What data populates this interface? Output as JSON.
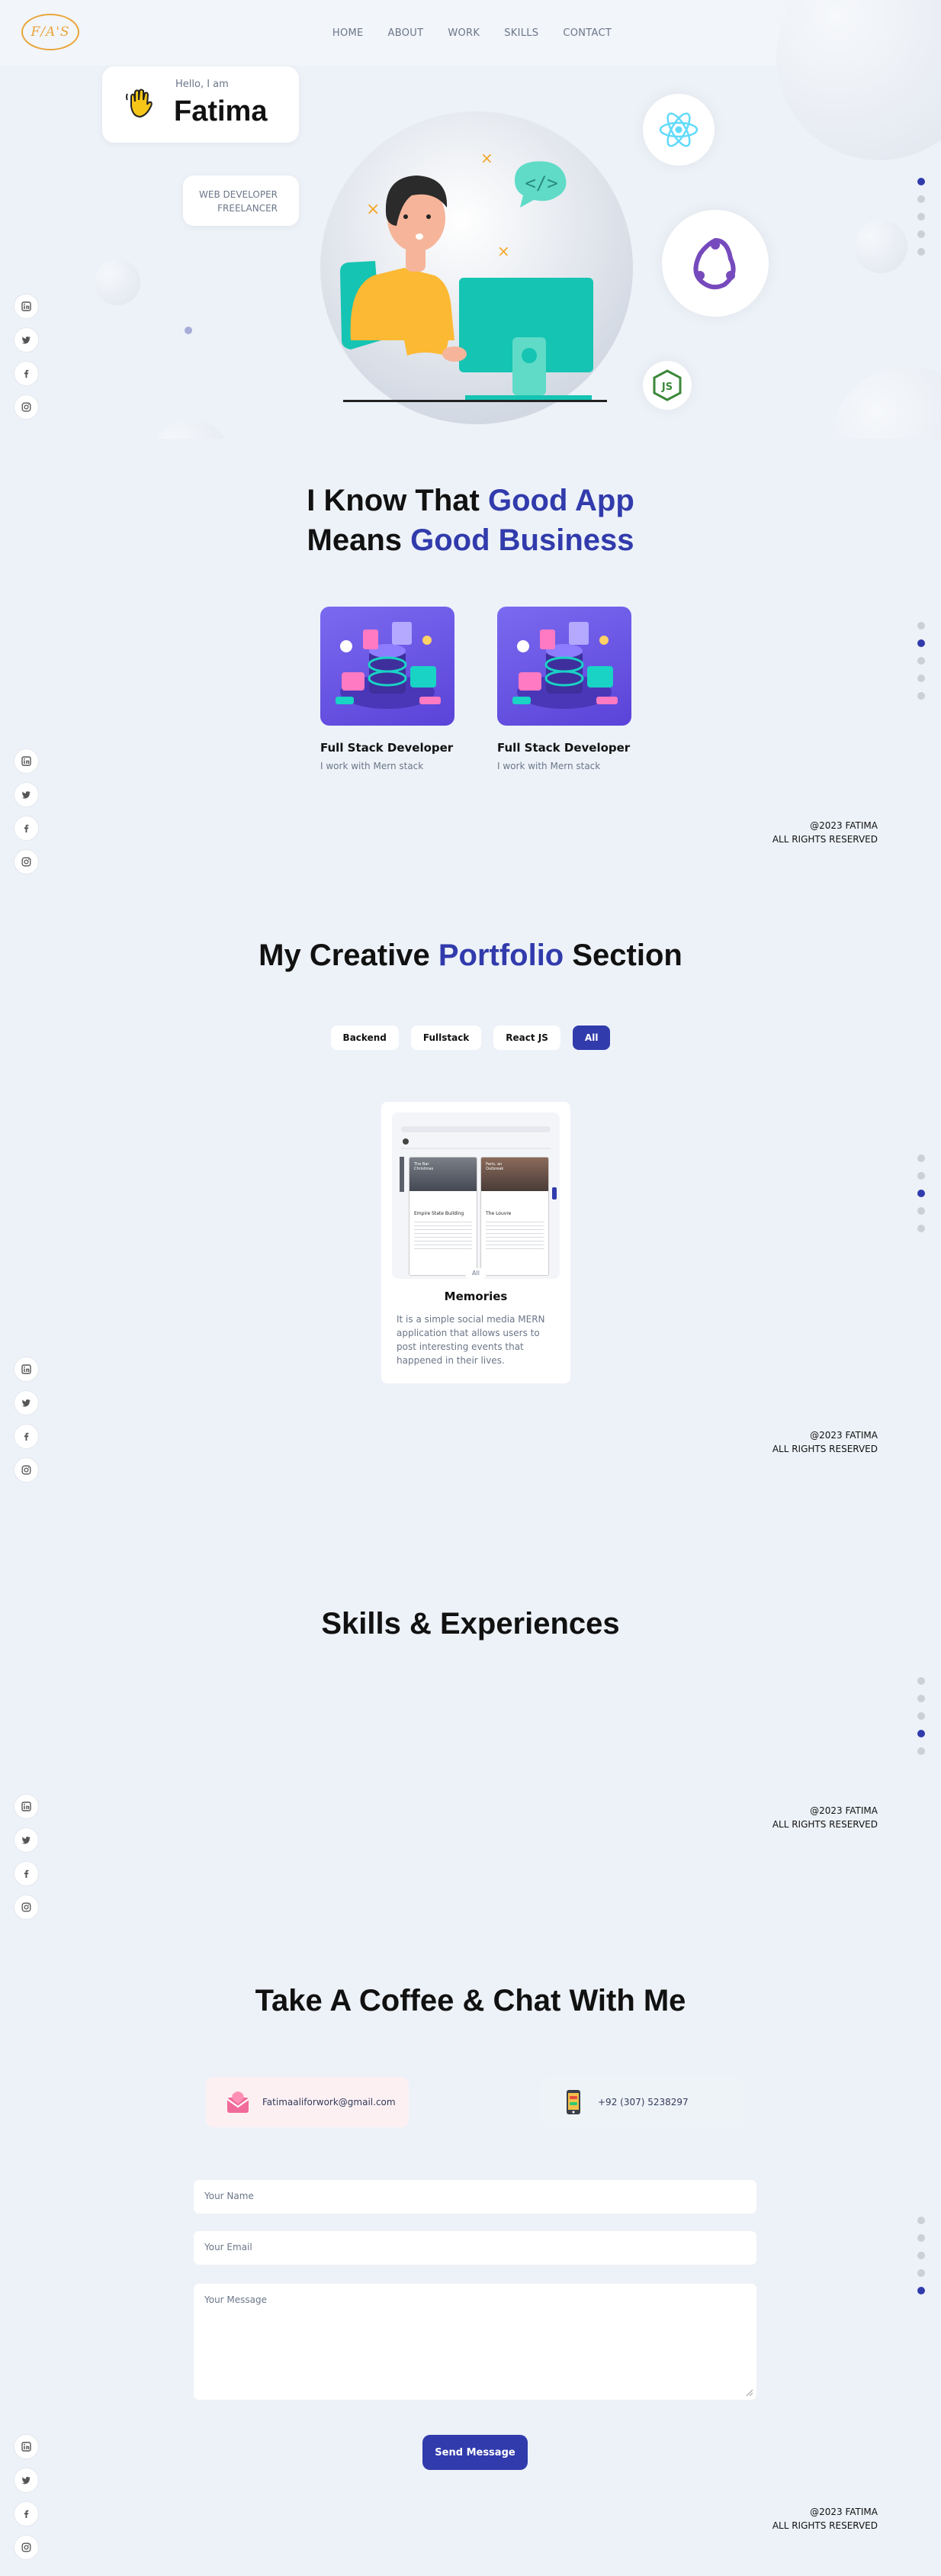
{
  "nav": {
    "logo_text": "F/A'S",
    "links": [
      "HOME",
      "ABOUT",
      "WORK",
      "SKILLS",
      "CONTACT"
    ]
  },
  "header": {
    "greeting": "Hello, I am",
    "name": "Fatima",
    "roles": [
      "WEB DEVELOPER",
      "FREELANCER"
    ],
    "tech_icons": [
      "react-icon",
      "redux-icon",
      "nodejs-icon"
    ]
  },
  "about": {
    "title_part1": "I Know That ",
    "title_accent1": "Good App",
    "title_part2": "Means ",
    "title_accent2": "Good Business",
    "cards": [
      {
        "title": "Full Stack Developer",
        "desc": "I work with Mern stack"
      },
      {
        "title": "Full Stack Developer",
        "desc": "I work with Mern stack"
      }
    ]
  },
  "work": {
    "title_part1": "My Creative ",
    "title_accent": "Portfolio",
    "title_part2": " Section",
    "filters": [
      "Backend",
      "Fullstack",
      "React JS",
      "All"
    ],
    "active_filter": "All",
    "project": {
      "title": "Memories",
      "desc": "It is a simple social media MERN application that allows users to post interesting events that happened in their lives.",
      "preview_cards": [
        {
          "overlay": "The Bar Christmas",
          "heading": "Empire State Building"
        },
        {
          "overlay": "Paris, an Outbreak",
          "heading": "The Louvre"
        }
      ],
      "preview_tag": "All"
    }
  },
  "skills": {
    "title": "Skills & Experiences"
  },
  "contact": {
    "title": "Take A Coffee & Chat With Me",
    "email": "Fatimaaliforwork@gmail.com",
    "phone": "+92 (307) 5238297",
    "name_placeholder": "Your Name",
    "email_placeholder": "Your Email",
    "message_placeholder": "Your Message",
    "send_label": "Send Message"
  },
  "footer": {
    "line1": "@2023 FATIMA",
    "line2": "ALL RIGHTS RESERVED"
  },
  "colors": {
    "primary": "#313bac",
    "background": "#edf2f8",
    "gray": "#6b7688",
    "accent_orange": "#e9a53a"
  },
  "social_icons": [
    "linkedin-icon",
    "twitter-icon",
    "facebook-icon",
    "instagram-icon"
  ],
  "section_dots": {
    "count": 5,
    "active_per_section": [
      0,
      1,
      2,
      3,
      4
    ]
  }
}
